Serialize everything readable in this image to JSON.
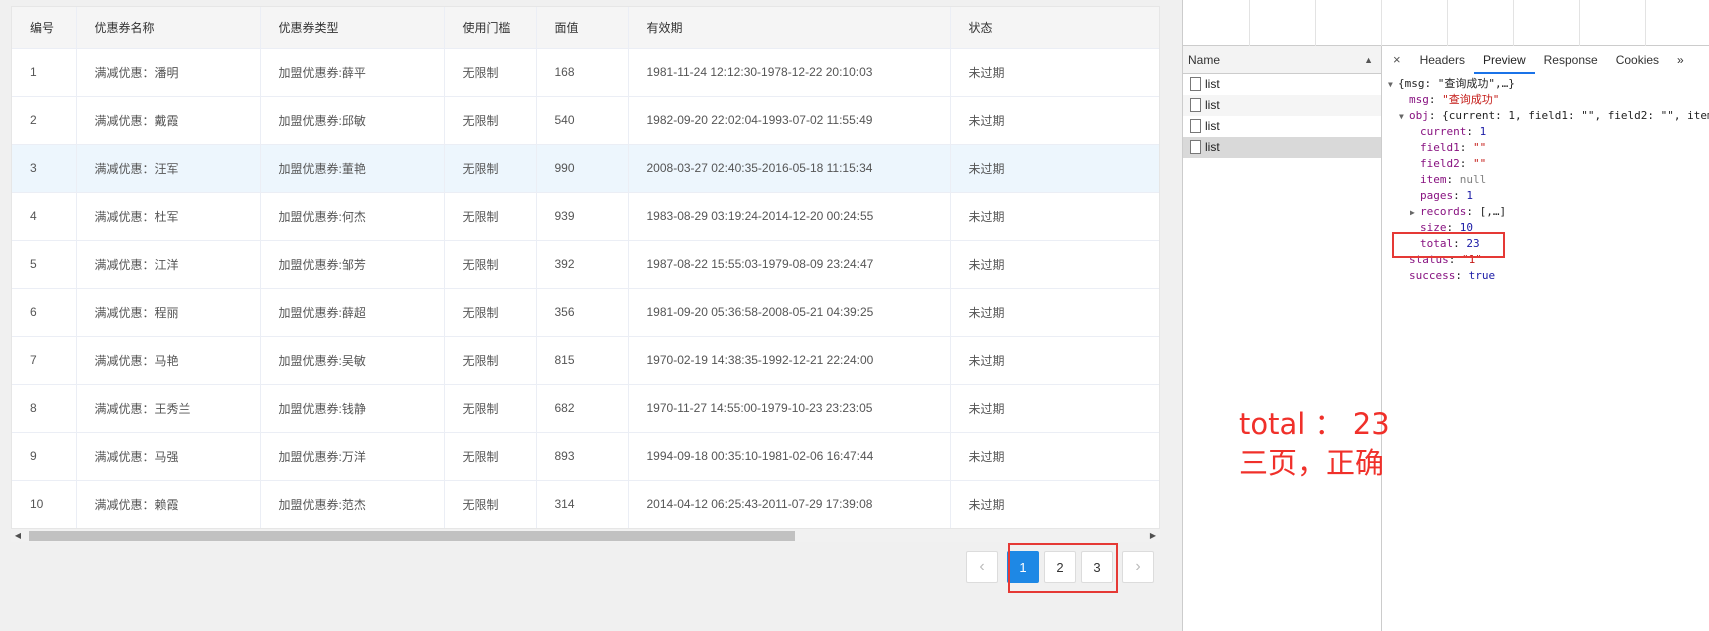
{
  "table": {
    "headers": [
      "编号",
      "优惠券名称",
      "优惠券类型",
      "使用门槛",
      "面值",
      "有效期",
      "状态"
    ],
    "rows": [
      {
        "id": "1",
        "name": "满减优惠：潘明",
        "type": "加盟优惠券:薛平",
        "threshold": "无限制",
        "value": "168",
        "period": "1981-11-24 12:12:30-1978-12-22 20:10:03",
        "status": "未过期"
      },
      {
        "id": "2",
        "name": "满减优惠：戴霞",
        "type": "加盟优惠券:邱敏",
        "threshold": "无限制",
        "value": "540",
        "period": "1982-09-20 22:02:04-1993-07-02 11:55:49",
        "status": "未过期"
      },
      {
        "id": "3",
        "name": "满减优惠：汪军",
        "type": "加盟优惠券:董艳",
        "threshold": "无限制",
        "value": "990",
        "period": "2008-03-27 02:40:35-2016-05-18 11:15:34",
        "status": "未过期"
      },
      {
        "id": "4",
        "name": "满减优惠：杜军",
        "type": "加盟优惠券:何杰",
        "threshold": "无限制",
        "value": "939",
        "period": "1983-08-29 03:19:24-2014-12-20 00:24:55",
        "status": "未过期"
      },
      {
        "id": "5",
        "name": "满减优惠：江洋",
        "type": "加盟优惠券:邹芳",
        "threshold": "无限制",
        "value": "392",
        "period": "1987-08-22 15:55:03-1979-08-09 23:24:47",
        "status": "未过期"
      },
      {
        "id": "6",
        "name": "满减优惠：程丽",
        "type": "加盟优惠券:薛超",
        "threshold": "无限制",
        "value": "356",
        "period": "1981-09-20 05:36:58-2008-05-21 04:39:25",
        "status": "未过期"
      },
      {
        "id": "7",
        "name": "满减优惠：马艳",
        "type": "加盟优惠券:吴敏",
        "threshold": "无限制",
        "value": "815",
        "period": "1970-02-19 14:38:35-1992-12-21 22:24:00",
        "status": "未过期"
      },
      {
        "id": "8",
        "name": "满减优惠：王秀兰",
        "type": "加盟优惠券:钱静",
        "threshold": "无限制",
        "value": "682",
        "period": "1970-11-27 14:55:00-1979-10-23 23:23:05",
        "status": "未过期"
      },
      {
        "id": "9",
        "name": "满减优惠：马强",
        "type": "加盟优惠券:万洋",
        "threshold": "无限制",
        "value": "893",
        "period": "1994-09-18 00:35:10-1981-02-06 16:47:44",
        "status": "未过期"
      },
      {
        "id": "10",
        "name": "满减优惠：赖霞",
        "type": "加盟优惠券:范杰",
        "threshold": "无限制",
        "value": "314",
        "period": "2014-04-12 06:25:43-2011-07-29 17:39:08",
        "status": "未过期"
      }
    ],
    "highlighted_row": 3
  },
  "pagination": {
    "prev": "‹",
    "next": "›",
    "pages": [
      "1",
      "2",
      "3"
    ],
    "current": "1"
  },
  "devtools": {
    "name_header": "Name",
    "requests": [
      "list",
      "list",
      "list",
      "list"
    ],
    "close": "×",
    "tabs": [
      "Headers",
      "Preview",
      "Response",
      "Cookies"
    ],
    "active_tab": "Preview",
    "more": "»",
    "preview": {
      "root": "{msg: \"查询成功\",…}",
      "msg_key": "msg",
      "msg_val": "\"查询成功\"",
      "obj_key": "obj",
      "obj_summary": "{current: 1, field1: \"\", field2: \"\", item",
      "current_key": "current",
      "current_val": "1",
      "field1_key": "field1",
      "field1_val": "\"\"",
      "field2_key": "field2",
      "field2_val": "\"\"",
      "item_key": "item",
      "item_val": "null",
      "pages_key": "pages",
      "pages_val": "1",
      "records_key": "records",
      "records_val": "[,…]",
      "size_key": "size",
      "size_val": "10",
      "total_key": "total",
      "total_val": "23",
      "status_key": "status",
      "status_val": "\"1\"",
      "success_key": "success",
      "success_val": "true"
    }
  },
  "annotation": {
    "line1": "total ： 23",
    "line2": "三页，正确"
  },
  "colors": {
    "accent": "#1e88e5",
    "highlight": "#e53935"
  }
}
